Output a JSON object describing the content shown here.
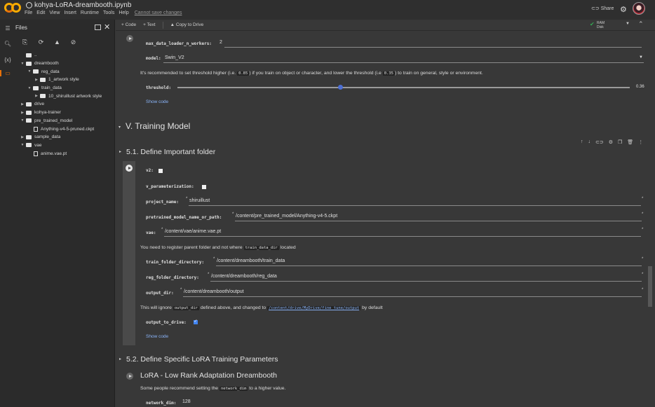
{
  "app": {
    "notebook_title": "kohya-LoRA-dreambooth.ipynb",
    "menu": [
      "File",
      "Edit",
      "View",
      "Insert",
      "Runtime",
      "Tools",
      "Help"
    ],
    "save_warning": "Cannot save changes",
    "share_label": "Share"
  },
  "toolbar": {
    "add_code": "+ Code",
    "add_text": "+ Text",
    "copy_to_drive": "Copy to Drive",
    "ram_label": "RAM",
    "disk_label": "Disk"
  },
  "files_panel": {
    "title": "Files",
    "tree": [
      {
        "name": "..",
        "type": "folder",
        "depth": 0,
        "expanded": null
      },
      {
        "name": "dreambooth",
        "type": "folder",
        "depth": 0,
        "expanded": true
      },
      {
        "name": "reg_data",
        "type": "folder",
        "depth": 1,
        "expanded": true
      },
      {
        "name": "1_artwork style",
        "type": "folder",
        "depth": 2,
        "expanded": false
      },
      {
        "name": "train_data",
        "type": "folder",
        "depth": 1,
        "expanded": true
      },
      {
        "name": "10_shiruillust artwork style",
        "type": "folder",
        "depth": 2,
        "expanded": false
      },
      {
        "name": "drive",
        "type": "folder",
        "depth": 0,
        "expanded": false
      },
      {
        "name": "kohya-trainer",
        "type": "folder",
        "depth": 0,
        "expanded": false
      },
      {
        "name": "pre_trained_model",
        "type": "folder",
        "depth": 0,
        "expanded": true
      },
      {
        "name": "Anything-v4-5-pruned.ckpt",
        "type": "file",
        "depth": 1,
        "expanded": null
      },
      {
        "name": "sample_data",
        "type": "folder",
        "depth": 0,
        "expanded": false
      },
      {
        "name": "vae",
        "type": "folder",
        "depth": 0,
        "expanded": true
      },
      {
        "name": "anime.vae.pt",
        "type": "file",
        "depth": 1,
        "expanded": null
      }
    ]
  },
  "cell_top": {
    "max_workers_label": "max_data_loader_n_workers:",
    "max_workers_value": "2",
    "model_label": "model:",
    "model_value": "Swin_V2",
    "threshold_note_1": "It's recommended to set threshold higher (i.e. ",
    "threshold_code_1": "0.85",
    "threshold_note_2": ") if you train on object or character, and lower the threshold (i.e ",
    "threshold_code_2": "0.35",
    "threshold_note_3": ") to train on general, style or environment.",
    "threshold_label": "threshold:",
    "threshold_value": "0.36",
    "threshold_fraction": 0.36,
    "show_code": "Show code"
  },
  "sections": {
    "training_model": "V. Training Model",
    "define_folder": "5.1. Define Important folder",
    "define_lora": "5.2. Define Specific LoRA Training Parameters",
    "lora_title": "LoRA - Low Rank Adaptation Dreambooth"
  },
  "folder_cell": {
    "v2_label": "v2:",
    "v2_checked": false,
    "v_param_label": "v_parameterization:",
    "v_param_checked": false,
    "project_name_label": "project_name:",
    "project_name_value": "shiruillust",
    "pretrained_label": "pretrained_model_name_or_path:",
    "pretrained_value": "/content/pre_trained_model/Anything-v4-5.ckpt",
    "vae_label": "vae:",
    "vae_value": "/content/vae/anime.vae.pt",
    "register_note_1": "You need to register parent folder and not where ",
    "register_code": "train_data_dir",
    "register_note_2": " located",
    "train_folder_label": "train_folder_directory:",
    "train_folder_value": "/content/dreambooth/train_data",
    "reg_folder_label": "reg_folder_directory:",
    "reg_folder_value": "/content/dreambooth/reg_data",
    "output_dir_label": "output_dir:",
    "output_dir_value": "/content/dreambooth/output",
    "ignore_note_1": "This will ignore ",
    "ignore_code": "output_dir",
    "ignore_note_2": " defined above, and changed to ",
    "ignore_link": "/content/drive/MyDrive/fine_tune/output",
    "ignore_note_3": " by default",
    "output_to_drive_label": "output_to_drive:",
    "output_to_drive_checked": true,
    "show_code": "Show code"
  },
  "lora_cell": {
    "note_1": "Some people recommend setting the ",
    "note_code": "network_dim",
    "note_2": " to a higher value.",
    "network_dim_label": "network_dim:",
    "network_dim_value": "128"
  }
}
